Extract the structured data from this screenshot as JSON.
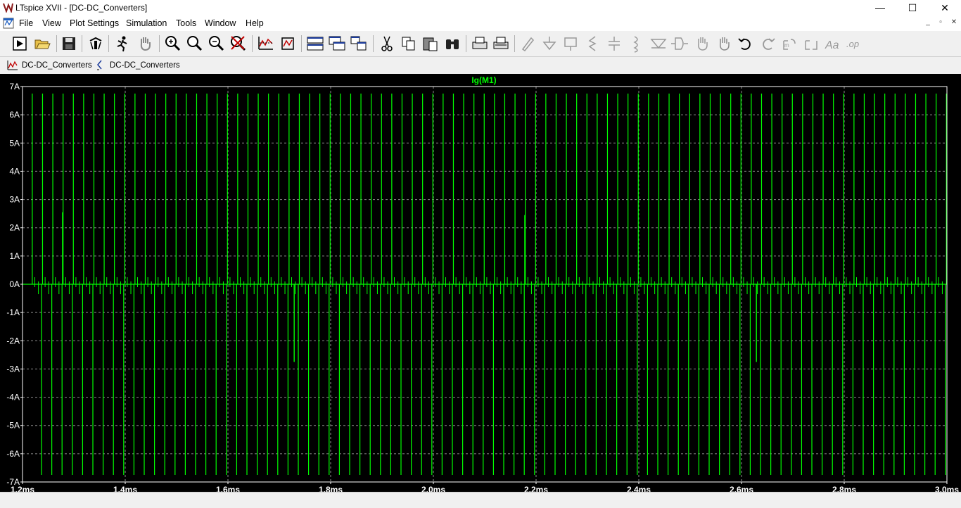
{
  "window": {
    "title": "LTspice XVII - [DC-DC_Converters]",
    "controls": {
      "minimize": "—",
      "maximize": "☐",
      "close": "✕"
    }
  },
  "menu": {
    "items": [
      "File",
      "View",
      "Plot Settings",
      "Simulation",
      "Tools",
      "Window",
      "Help"
    ]
  },
  "toolbar": {
    "icons": [
      "run-icon",
      "open-icon",
      "save-icon",
      "control-panel-icon",
      "run-halt-icon",
      "pan-icon",
      "zoom-in-icon",
      "zoom-area-icon",
      "zoom-out-icon",
      "zoom-cancel-icon",
      "autorange-icon",
      "plot-settings-icon",
      "tile-horizontal-icon",
      "cascade-icon",
      "tile-vertical-icon",
      "cut-icon",
      "copy-icon",
      "paste-icon",
      "find-icon",
      "print-icon",
      "print-setup-icon",
      "draw-wire-icon",
      "ground-icon",
      "label-net-icon",
      "resistor-icon",
      "capacitor-icon",
      "inductor-icon",
      "diode-icon",
      "component-icon",
      "move-icon",
      "drag-icon",
      "undo-icon",
      "redo-icon",
      "rotate-icon",
      "mirror-icon",
      "text-icon",
      "spice-directive-icon"
    ]
  },
  "tabs": [
    {
      "label": "DC-DC_Converters",
      "icon": "waveform-icon"
    },
    {
      "label": "DC-DC_Converters",
      "icon": "schematic-icon"
    }
  ],
  "chart_data": {
    "type": "line",
    "title": "Ig(M1)",
    "xlabel": "",
    "ylabel": "",
    "x_ticks": [
      "1.2ms",
      "1.4ms",
      "1.6ms",
      "1.8ms",
      "2.0ms",
      "2.2ms",
      "2.4ms",
      "2.6ms",
      "2.8ms",
      "3.0ms"
    ],
    "y_ticks": [
      "7A",
      "6A",
      "5A",
      "4A",
      "3A",
      "2A",
      "1A",
      "0A",
      "-1A",
      "-2A",
      "-3A",
      "-4A",
      "-5A",
      "-6A",
      "-7A"
    ],
    "xlim": [
      1.2,
      3.0
    ],
    "ylim": [
      -7,
      7
    ],
    "grid": true,
    "colors": {
      "trace": "#00ff00",
      "grid": "#8c8c8c",
      "text": "#ffffff",
      "background": "#000000"
    },
    "series": [
      {
        "name": "Ig(M1)",
        "baseline": 0,
        "pulse_period_ms": 0.02,
        "first_pulse_ms": 1.219,
        "positive_spike_A": 6.75,
        "negative_spike_A": -6.75,
        "anomalies": [
          {
            "x_ms": 1.278,
            "y_A": 2.55
          },
          {
            "x_ms": 1.729,
            "y_A": -2.75
          },
          {
            "x_ms": 2.178,
            "y_A": 2.45
          },
          {
            "x_ms": 2.629,
            "y_A": -2.75
          }
        ]
      }
    ]
  }
}
